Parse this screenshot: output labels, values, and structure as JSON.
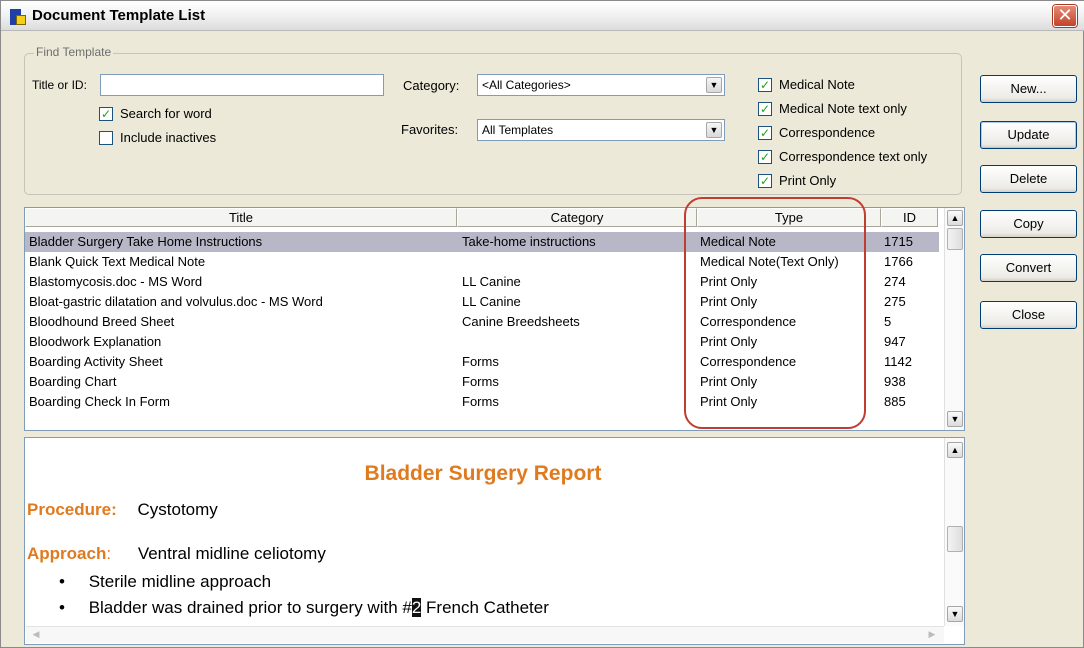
{
  "window": {
    "title": "Document Template List",
    "close_label": "✕"
  },
  "find": {
    "legend": "Find Template",
    "title_label": "Title or ID:",
    "title_value": "",
    "category_label": "Category:",
    "category_value": "<All Categories>",
    "favorites_label": "Favorites:",
    "favorites_value": "All Templates",
    "search_for_word": {
      "label": "Search for word",
      "checked": true
    },
    "include_inactives": {
      "label": "Include inactives",
      "checked": false
    },
    "type_filters": [
      {
        "label": "Medical Note",
        "checked": true
      },
      {
        "label": "Medical Note text only",
        "checked": true
      },
      {
        "label": "Correspondence",
        "checked": true
      },
      {
        "label": "Correspondence text only",
        "checked": true
      },
      {
        "label": "Print Only",
        "checked": true
      }
    ]
  },
  "buttons": {
    "new": "New...",
    "update": "Update",
    "delete": "Delete",
    "copy": "Copy",
    "convert": "Convert",
    "close": "Close"
  },
  "grid": {
    "columns": [
      "Title",
      "Category",
      "Type",
      "ID"
    ],
    "rows": [
      {
        "title": "Bladder Surgery Take Home Instructions",
        "category": "Take-home instructions",
        "type": "Medical Note",
        "id": "1715"
      },
      {
        "title": "Blank Quick Text Medical Note",
        "category": "",
        "type": "Medical Note(Text Only)",
        "id": "1766"
      },
      {
        "title": "Blastomycosis.doc - MS Word",
        "category": "LL Canine",
        "type": "Print Only",
        "id": "274"
      },
      {
        "title": "Bloat-gastric dilatation and volvulus.doc - MS Word",
        "category": "LL Canine",
        "type": "Print Only",
        "id": "275"
      },
      {
        "title": "Bloodhound Breed Sheet",
        "category": "Canine Breedsheets",
        "type": "Correspondence",
        "id": "5"
      },
      {
        "title": "Bloodwork Explanation",
        "category": "",
        "type": "Print Only",
        "id": "947"
      },
      {
        "title": "Boarding Activity Sheet",
        "category": "Forms",
        "type": "Correspondence",
        "id": "1142"
      },
      {
        "title": "Boarding Chart",
        "category": "Forms",
        "type": "Print Only",
        "id": "938"
      },
      {
        "title": "Boarding Check In Form",
        "category": "Forms",
        "type": "Print Only",
        "id": "885"
      }
    ]
  },
  "preview": {
    "title": "Bladder Surgery Report",
    "procedure_label": "Procedure:",
    "procedure_value": "Cystotomy",
    "approach_label": "Approach",
    "approach_colon": ":",
    "approach_value": "Ventral midline celiotomy",
    "bullets": [
      {
        "before": "Sterile midline approach",
        "highlight": "",
        "after": ""
      },
      {
        "before": "Bladder was drained prior to surgery with #",
        "highlight": "2",
        "after": " French Catheter"
      }
    ],
    "bullet_char": "•"
  }
}
